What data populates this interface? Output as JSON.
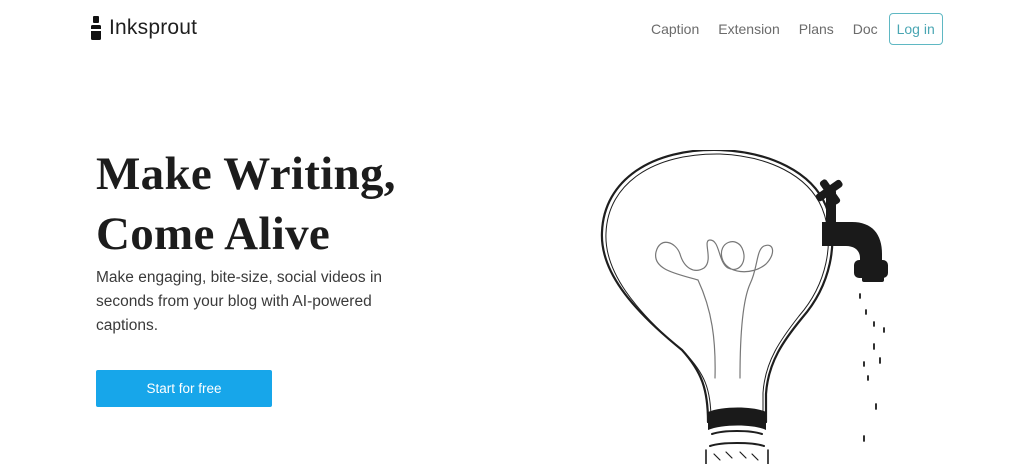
{
  "brand": {
    "name": "Inksprout",
    "icon": "ink-bottle-icon"
  },
  "nav": {
    "links": [
      "Caption",
      "Extension",
      "Plans",
      "Doc"
    ],
    "login_label": "Log in"
  },
  "hero": {
    "title_line1": "Make Writing,",
    "title_line2": "Come Alive",
    "subtitle": "Make engaging, bite-size, social videos in seconds from your blog with AI-powered captions.",
    "cta_label": "Start for free",
    "illustration_icon": "lightbulb-faucet-illustration"
  },
  "colors": {
    "accent": "#17a6ea",
    "login_border": "#5fb8c3",
    "title": "#1c1c1c"
  }
}
